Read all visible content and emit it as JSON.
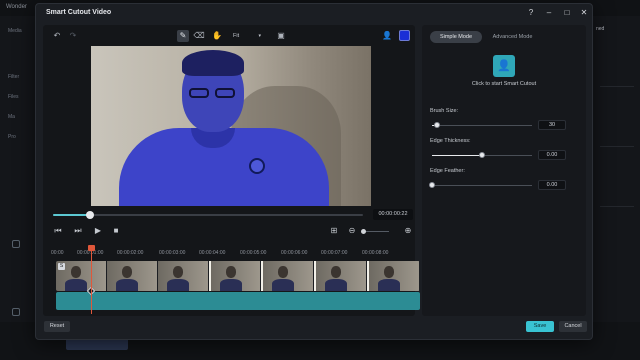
{
  "background_app": {
    "title": "Wonder",
    "left_labels": [
      "Media",
      "Filter",
      "Files",
      "Ma",
      "Pro"
    ],
    "right_chip": "ned",
    "bottom_hint": "Click to start Smart Cutout"
  },
  "dialog": {
    "title": "Smart Cutout Video",
    "window_buttons": [
      "help-icon",
      "minimize-icon",
      "maximize-icon",
      "close-icon"
    ]
  },
  "toolbar": {
    "fit_label": "Fit",
    "mask_color": "#1b2fd6"
  },
  "player": {
    "timecode": "00:00:00:22",
    "progress": 0.12
  },
  "timeline": {
    "ruler": [
      "00:00",
      "00:00:01:00",
      "00:00:02:00",
      "00:00:03:00",
      "00:00:04:00",
      "00:00:05:00",
      "00:00:06:00",
      "00:00:07:00",
      "00:00:08:00"
    ],
    "track_tag": "S"
  },
  "right_panel": {
    "tab_simple": "Simple Mode",
    "tab_advanced": "Advanced Mode",
    "cutout_hint": "Click to start Smart Cutout",
    "brush_size_label": "Brush Size:",
    "brush_size_value": "30",
    "brush_size_level": 0.05,
    "edge_thickness_label": "Edge Thickness:",
    "edge_thickness_value": "0.00",
    "edge_thickness_level": 0.5,
    "edge_feather_label": "Edge Feather:",
    "edge_feather_value": "0.00",
    "edge_feather_level": 0.0
  },
  "footer": {
    "reset_label": "Reset",
    "save_label": "Save",
    "cancel_label": "Cancel"
  }
}
